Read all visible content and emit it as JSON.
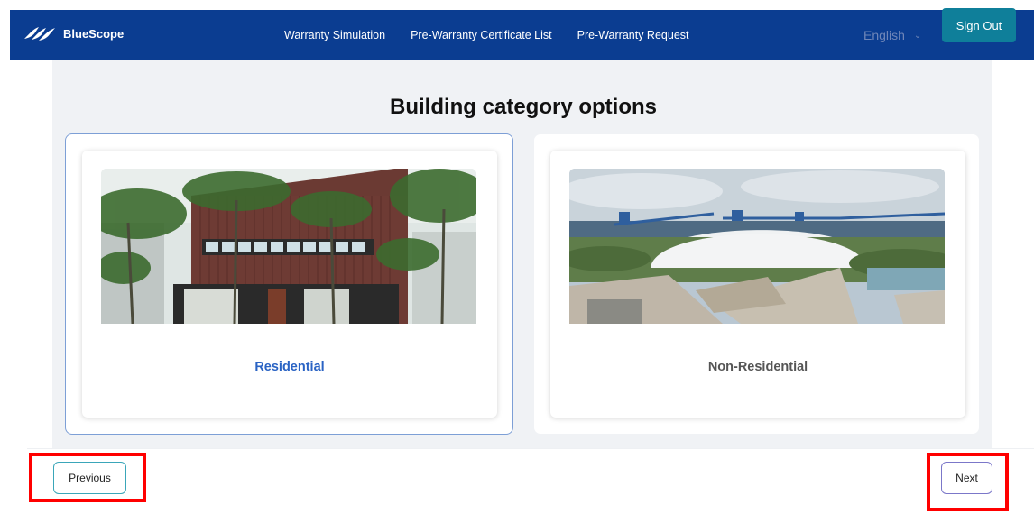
{
  "header": {
    "logo_text": "BlueScope",
    "nav": [
      {
        "label": "Warranty Simulation",
        "active": true
      },
      {
        "label": "Pre-Warranty Certificate List",
        "active": false
      },
      {
        "label": "Pre-Warranty Request",
        "active": false
      }
    ],
    "language": "English",
    "sign_out_label": "Sign Out"
  },
  "page": {
    "title": "Building category options",
    "options": [
      {
        "label": "Residential",
        "selected": true,
        "image": "residential-building-photo"
      },
      {
        "label": "Non-Residential",
        "selected": false,
        "image": "industrial-facility-photo"
      }
    ]
  },
  "footer": {
    "previous_label": "Previous",
    "next_label": "Next"
  },
  "colors": {
    "nav_bg": "#0b3d91",
    "sign_out_bg": "#0f7f9a",
    "selected_text": "#2a63c4",
    "highlight": "#ff0000"
  }
}
